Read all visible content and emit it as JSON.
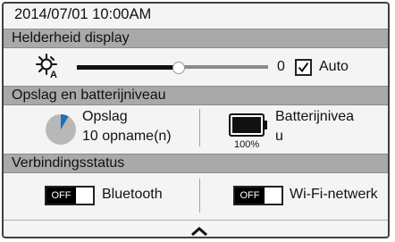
{
  "status": {
    "datetime": "2014/07/01  10:00AM"
  },
  "sections": {
    "brightness": {
      "title": "Helderheid display",
      "icon": "auto-brightness-icon",
      "slider_value_label": "0",
      "slider_fraction": 0.49,
      "auto_checked": true,
      "auto_label": "Auto"
    },
    "storage": {
      "title": "Opslag en batterijniveau",
      "storage_label": "Opslag",
      "storage_count": "10 opname(n)",
      "storage_used_fraction": 0.08,
      "battery_label_line1": "Batterijnivea",
      "battery_label_line2": "u",
      "battery_percent": "100%",
      "battery_level": 1.0
    },
    "connection": {
      "title": "Verbindingsstatus",
      "bluetooth_toggle": "OFF",
      "bluetooth_label": "Bluetooth",
      "wifi_toggle": "OFF",
      "wifi_label": "Wi-Fi-netwerk"
    }
  },
  "footer": {
    "icon": "chevron-up-icon"
  },
  "colors": {
    "section_bar": "#a9a9a9",
    "storage_fill": "#1f6fb5",
    "pie_bg": "#b8b8b8",
    "toggle_off": "#000000"
  }
}
